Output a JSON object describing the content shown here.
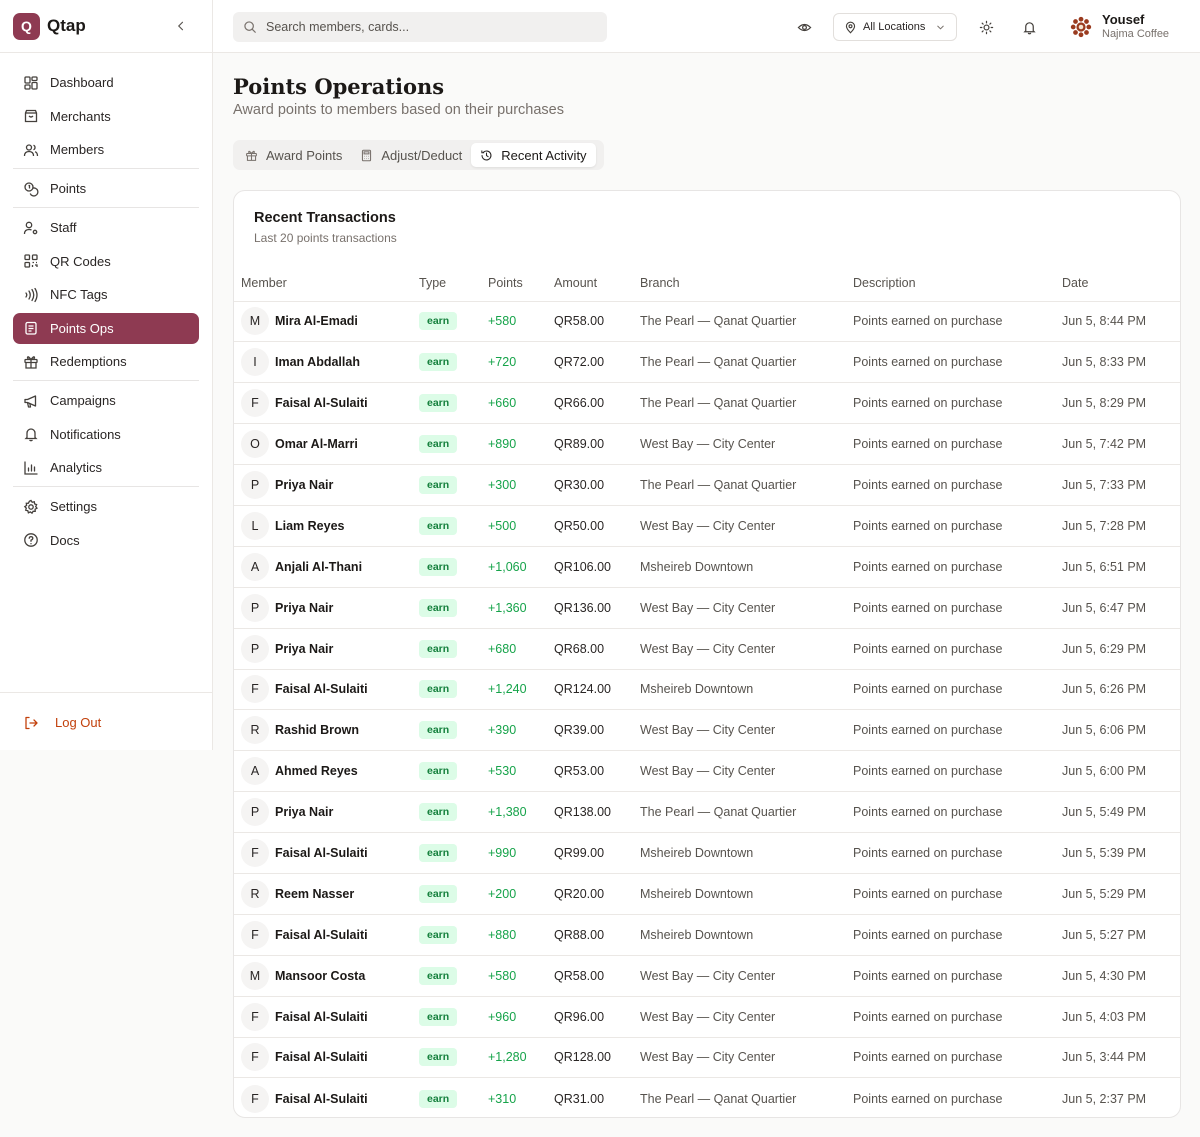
{
  "brand": {
    "initial": "Q",
    "name": "Qtap"
  },
  "sidebar": {
    "items": [
      {
        "label": "Dashboard",
        "icon": "dashboard-icon"
      },
      {
        "label": "Merchants",
        "icon": "store-icon"
      },
      {
        "label": "Members",
        "icon": "users-icon"
      },
      {
        "label": "Points",
        "icon": "coins-icon"
      },
      {
        "label": "Staff",
        "icon": "user-cog-icon"
      },
      {
        "label": "QR Codes",
        "icon": "qr-code-icon"
      },
      {
        "label": "NFC Tags",
        "icon": "nfc-icon"
      },
      {
        "label": "Points Ops",
        "icon": "clipboard-icon",
        "active": true
      },
      {
        "label": "Redemptions",
        "icon": "gift-icon"
      },
      {
        "label": "Campaigns",
        "icon": "megaphone-icon"
      },
      {
        "label": "Notifications",
        "icon": "bell-icon"
      },
      {
        "label": "Analytics",
        "icon": "bar-chart-icon"
      },
      {
        "label": "Settings",
        "icon": "settings-icon"
      },
      {
        "label": "Docs",
        "icon": "help-icon"
      }
    ],
    "logout_label": "Log Out"
  },
  "topbar": {
    "search_placeholder": "Search members, cards...",
    "location_label": "All Locations",
    "user_name": "Yousef",
    "user_org": "Najma Coffee"
  },
  "page": {
    "title": "Points Operations",
    "subtitle": "Award points to members based on their purchases"
  },
  "tabs": [
    {
      "label": "Award Points",
      "icon": "gift-icon"
    },
    {
      "label": "Adjust/Deduct",
      "icon": "calculator-icon"
    },
    {
      "label": "Recent Activity",
      "icon": "history-icon",
      "active": true
    }
  ],
  "transactions": {
    "title": "Recent Transactions",
    "subtitle": "Last 20 points transactions",
    "columns": [
      "Member",
      "Type",
      "Points",
      "Amount",
      "Branch",
      "Description",
      "Date"
    ],
    "rows": [
      {
        "initial": "M",
        "member": "Mira Al-Emadi",
        "type": "earn",
        "points": "+580",
        "amount": "QR58.00",
        "branch": "The Pearl — Qanat Quartier",
        "description": "Points earned on purchase",
        "date": "Jun 5, 8:44 PM"
      },
      {
        "initial": "I",
        "member": "Iman Abdallah",
        "type": "earn",
        "points": "+720",
        "amount": "QR72.00",
        "branch": "The Pearl — Qanat Quartier",
        "description": "Points earned on purchase",
        "date": "Jun 5, 8:33 PM"
      },
      {
        "initial": "F",
        "member": "Faisal Al-Sulaiti",
        "type": "earn",
        "points": "+660",
        "amount": "QR66.00",
        "branch": "The Pearl — Qanat Quartier",
        "description": "Points earned on purchase",
        "date": "Jun 5, 8:29 PM"
      },
      {
        "initial": "O",
        "member": "Omar Al-Marri",
        "type": "earn",
        "points": "+890",
        "amount": "QR89.00",
        "branch": "West Bay — City Center",
        "description": "Points earned on purchase",
        "date": "Jun 5, 7:42 PM"
      },
      {
        "initial": "P",
        "member": "Priya Nair",
        "type": "earn",
        "points": "+300",
        "amount": "QR30.00",
        "branch": "The Pearl — Qanat Quartier",
        "description": "Points earned on purchase",
        "date": "Jun 5, 7:33 PM"
      },
      {
        "initial": "L",
        "member": "Liam Reyes",
        "type": "earn",
        "points": "+500",
        "amount": "QR50.00",
        "branch": "West Bay — City Center",
        "description": "Points earned on purchase",
        "date": "Jun 5, 7:28 PM"
      },
      {
        "initial": "A",
        "member": "Anjali Al-Thani",
        "type": "earn",
        "points": "+1,060",
        "amount": "QR106.00",
        "branch": "Msheireb Downtown",
        "description": "Points earned on purchase",
        "date": "Jun 5, 6:51 PM"
      },
      {
        "initial": "P",
        "member": "Priya Nair",
        "type": "earn",
        "points": "+1,360",
        "amount": "QR136.00",
        "branch": "West Bay — City Center",
        "description": "Points earned on purchase",
        "date": "Jun 5, 6:47 PM"
      },
      {
        "initial": "P",
        "member": "Priya Nair",
        "type": "earn",
        "points": "+680",
        "amount": "QR68.00",
        "branch": "West Bay — City Center",
        "description": "Points earned on purchase",
        "date": "Jun 5, 6:29 PM"
      },
      {
        "initial": "F",
        "member": "Faisal Al-Sulaiti",
        "type": "earn",
        "points": "+1,240",
        "amount": "QR124.00",
        "branch": "Msheireb Downtown",
        "description": "Points earned on purchase",
        "date": "Jun 5, 6:26 PM"
      },
      {
        "initial": "R",
        "member": "Rashid Brown",
        "type": "earn",
        "points": "+390",
        "amount": "QR39.00",
        "branch": "West Bay — City Center",
        "description": "Points earned on purchase",
        "date": "Jun 5, 6:06 PM"
      },
      {
        "initial": "A",
        "member": "Ahmed Reyes",
        "type": "earn",
        "points": "+530",
        "amount": "QR53.00",
        "branch": "West Bay — City Center",
        "description": "Points earned on purchase",
        "date": "Jun 5, 6:00 PM"
      },
      {
        "initial": "P",
        "member": "Priya Nair",
        "type": "earn",
        "points": "+1,380",
        "amount": "QR138.00",
        "branch": "The Pearl — Qanat Quartier",
        "description": "Points earned on purchase",
        "date": "Jun 5, 5:49 PM"
      },
      {
        "initial": "F",
        "member": "Faisal Al-Sulaiti",
        "type": "earn",
        "points": "+990",
        "amount": "QR99.00",
        "branch": "Msheireb Downtown",
        "description": "Points earned on purchase",
        "date": "Jun 5, 5:39 PM"
      },
      {
        "initial": "R",
        "member": "Reem Nasser",
        "type": "earn",
        "points": "+200",
        "amount": "QR20.00",
        "branch": "Msheireb Downtown",
        "description": "Points earned on purchase",
        "date": "Jun 5, 5:29 PM"
      },
      {
        "initial": "F",
        "member": "Faisal Al-Sulaiti",
        "type": "earn",
        "points": "+880",
        "amount": "QR88.00",
        "branch": "Msheireb Downtown",
        "description": "Points earned on purchase",
        "date": "Jun 5, 5:27 PM"
      },
      {
        "initial": "M",
        "member": "Mansoor Costa",
        "type": "earn",
        "points": "+580",
        "amount": "QR58.00",
        "branch": "West Bay — City Center",
        "description": "Points earned on purchase",
        "date": "Jun 5, 4:30 PM"
      },
      {
        "initial": "F",
        "member": "Faisal Al-Sulaiti",
        "type": "earn",
        "points": "+960",
        "amount": "QR96.00",
        "branch": "West Bay — City Center",
        "description": "Points earned on purchase",
        "date": "Jun 5, 4:03 PM"
      },
      {
        "initial": "F",
        "member": "Faisal Al-Sulaiti",
        "type": "earn",
        "points": "+1,280",
        "amount": "QR128.00",
        "branch": "West Bay — City Center",
        "description": "Points earned on purchase",
        "date": "Jun 5, 3:44 PM"
      },
      {
        "initial": "F",
        "member": "Faisal Al-Sulaiti",
        "type": "earn",
        "points": "+310",
        "amount": "QR31.00",
        "branch": "The Pearl — Qanat Quartier",
        "description": "Points earned on purchase",
        "date": "Jun 5, 2:37 PM"
      }
    ]
  },
  "colors": {
    "accent": "#8e3a52",
    "earn_badge_bg": "#dcfce7",
    "earn_text": "#16a34a",
    "logout": "#c2410c"
  }
}
